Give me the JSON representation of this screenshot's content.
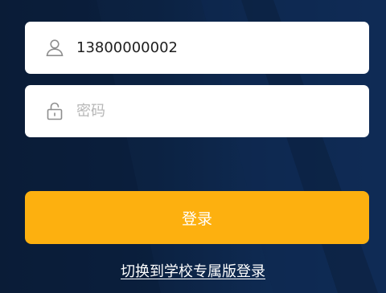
{
  "login_form": {
    "phone_field": {
      "value": "13800000002",
      "icon": "user-icon"
    },
    "password_field": {
      "value": "",
      "placeholder": "密码",
      "icon": "lock-icon"
    },
    "login_button_label": "登录",
    "switch_link_label": "切换到学校专属版登录"
  },
  "colors": {
    "background": "#0c2140",
    "field_background": "#ffffff",
    "placeholder": "#b7b7b7",
    "button": "#fdb00f",
    "button_text": "#ffffff",
    "link": "#ffffff"
  }
}
